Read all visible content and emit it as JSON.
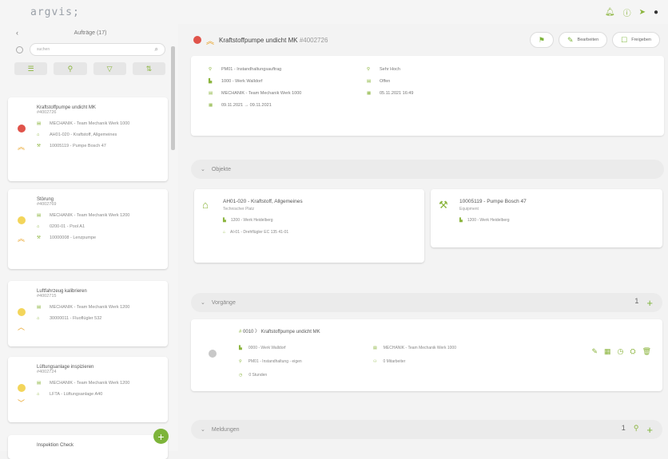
{
  "app": {
    "logo": "argvis;"
  },
  "topbar": {
    "icons": [
      "bell-icon",
      "help-icon",
      "send-icon",
      "user-icon"
    ]
  },
  "sidebar": {
    "title": "Aufträge (17)",
    "search_placeholder": "suchen",
    "cards": [
      {
        "title": "Kraftstoffpumpe undicht MK",
        "number": "#4002726",
        "status": "#e0534a",
        "priority": "high",
        "rows": [
          "MECHANIK - Team Mechanik Werk 1000",
          "AH01-020 - Kraftstoff, Allgemeines",
          "10005119 - Pumpe Bosch 47"
        ]
      },
      {
        "title": "Störung",
        "number": "#4002769",
        "status": "#f3d55b",
        "priority": "high",
        "rows": [
          "MECHANIK - Team Mechanik Werk 1200",
          "0200-01 - Pool A1",
          "10000008 - Lenzpumpe"
        ]
      },
      {
        "title": "Luftfahrzeug kalibrieren",
        "number": "#4002715",
        "status": "#f3d55b",
        "priority": "medium",
        "rows": [
          "MECHANIK - Team Mechanik Werk 1200",
          "30000011 - Fluoflügler 532"
        ]
      },
      {
        "title": "Lüftungsanlage inspizieren",
        "number": "#4002724",
        "status": "#f3d55b",
        "priority": "low",
        "rows": [
          "MECHANIK - Team Mechanik Werk 1200",
          "LFTA - Lüftungsanlage A40"
        ]
      },
      {
        "title": "Inspektion Check",
        "number": "",
        "status": "",
        "priority": "",
        "rows": []
      }
    ]
  },
  "header": {
    "title": "Kraftstoffpumpe undicht MK",
    "number": "#4002726",
    "edit_label": "Bearbeiten",
    "release_label": "Freigeben"
  },
  "info": {
    "left": [
      "PM01 - Instandhaltungsauftrag",
      "1000 - Werk Walldorf",
      "MECHANIK - Team Mechanik Werk 1000",
      "09.11.2021 → 09.11.2021"
    ],
    "right": [
      "Sehr Hoch",
      "Offen",
      "05.11.2021 16:49"
    ]
  },
  "objekte": {
    "label": "Objekte",
    "items": [
      {
        "title": "AH01-020 - Kraftstoff, Allgemeines",
        "subtitle": "Technischer Platz",
        "rows": [
          "1200 - Werk Heidelberg",
          "AI-01 - Drehflügler EC 135 41-01"
        ]
      },
      {
        "title": "10005119 - Pumpe Bosch 47",
        "subtitle": "Equipment",
        "rows": [
          "1200 - Werk Heidelberg"
        ]
      }
    ]
  },
  "vorgaenge": {
    "label": "Vorgänge",
    "count": "1",
    "item": {
      "header": "0010 〉 Kraftstoffpumpe undicht MK",
      "plant": "0000 - Werk Walldorf",
      "team": "MECHANIK - Team Mechanik Werk 1000",
      "type": "PM01 - Instandhaltung - eigen",
      "people": "0 Mitarbeiter",
      "duration": "0 Stunden"
    }
  },
  "meldungen": {
    "label": "Meldungen",
    "count": "1"
  }
}
